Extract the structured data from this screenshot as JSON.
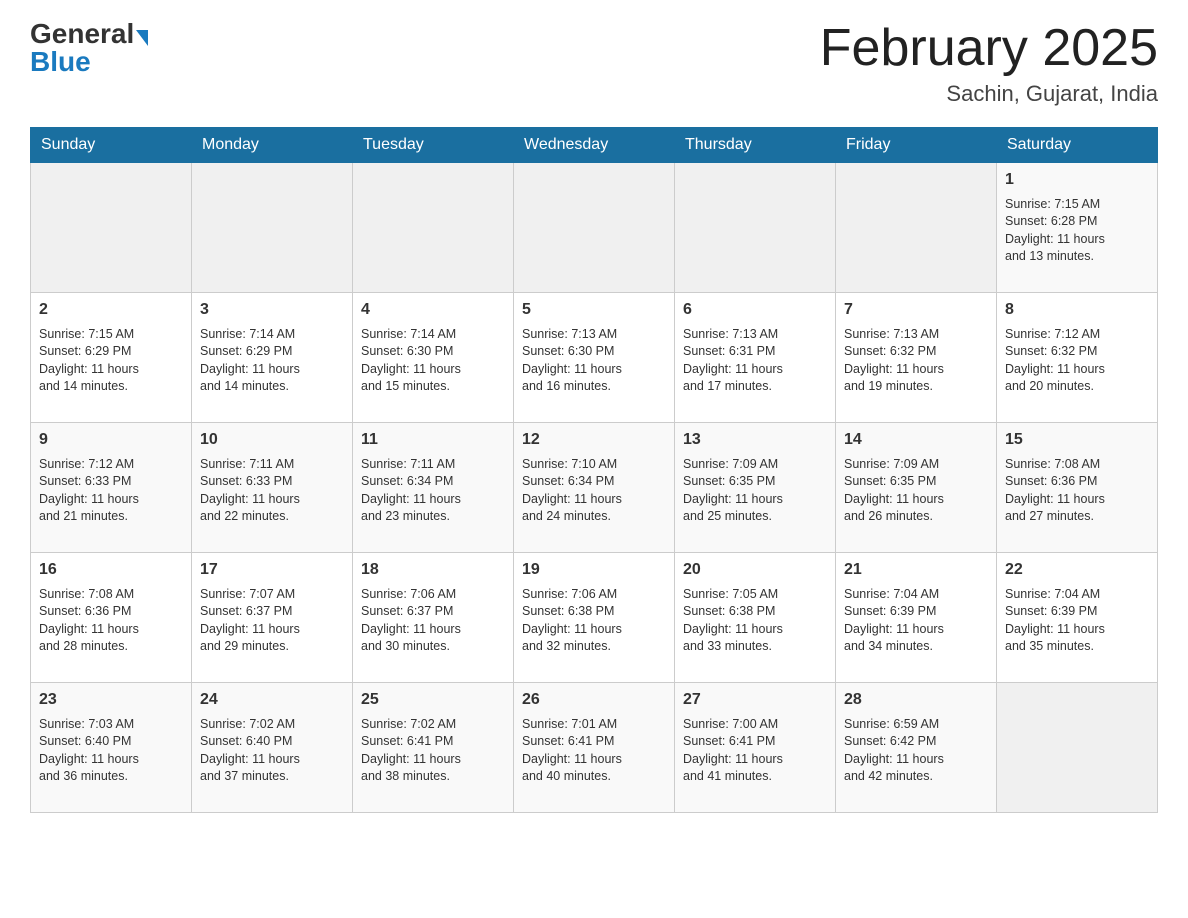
{
  "header": {
    "logo_general": "General",
    "logo_blue": "Blue",
    "month_title": "February 2025",
    "location": "Sachin, Gujarat, India"
  },
  "days_of_week": [
    "Sunday",
    "Monday",
    "Tuesday",
    "Wednesday",
    "Thursday",
    "Friday",
    "Saturday"
  ],
  "weeks": [
    {
      "days": [
        {
          "num": "",
          "info": ""
        },
        {
          "num": "",
          "info": ""
        },
        {
          "num": "",
          "info": ""
        },
        {
          "num": "",
          "info": ""
        },
        {
          "num": "",
          "info": ""
        },
        {
          "num": "",
          "info": ""
        },
        {
          "num": "1",
          "info": "Sunrise: 7:15 AM\nSunset: 6:28 PM\nDaylight: 11 hours\nand 13 minutes."
        }
      ]
    },
    {
      "days": [
        {
          "num": "2",
          "info": "Sunrise: 7:15 AM\nSunset: 6:29 PM\nDaylight: 11 hours\nand 14 minutes."
        },
        {
          "num": "3",
          "info": "Sunrise: 7:14 AM\nSunset: 6:29 PM\nDaylight: 11 hours\nand 14 minutes."
        },
        {
          "num": "4",
          "info": "Sunrise: 7:14 AM\nSunset: 6:30 PM\nDaylight: 11 hours\nand 15 minutes."
        },
        {
          "num": "5",
          "info": "Sunrise: 7:13 AM\nSunset: 6:30 PM\nDaylight: 11 hours\nand 16 minutes."
        },
        {
          "num": "6",
          "info": "Sunrise: 7:13 AM\nSunset: 6:31 PM\nDaylight: 11 hours\nand 17 minutes."
        },
        {
          "num": "7",
          "info": "Sunrise: 7:13 AM\nSunset: 6:32 PM\nDaylight: 11 hours\nand 19 minutes."
        },
        {
          "num": "8",
          "info": "Sunrise: 7:12 AM\nSunset: 6:32 PM\nDaylight: 11 hours\nand 20 minutes."
        }
      ]
    },
    {
      "days": [
        {
          "num": "9",
          "info": "Sunrise: 7:12 AM\nSunset: 6:33 PM\nDaylight: 11 hours\nand 21 minutes."
        },
        {
          "num": "10",
          "info": "Sunrise: 7:11 AM\nSunset: 6:33 PM\nDaylight: 11 hours\nand 22 minutes."
        },
        {
          "num": "11",
          "info": "Sunrise: 7:11 AM\nSunset: 6:34 PM\nDaylight: 11 hours\nand 23 minutes."
        },
        {
          "num": "12",
          "info": "Sunrise: 7:10 AM\nSunset: 6:34 PM\nDaylight: 11 hours\nand 24 minutes."
        },
        {
          "num": "13",
          "info": "Sunrise: 7:09 AM\nSunset: 6:35 PM\nDaylight: 11 hours\nand 25 minutes."
        },
        {
          "num": "14",
          "info": "Sunrise: 7:09 AM\nSunset: 6:35 PM\nDaylight: 11 hours\nand 26 minutes."
        },
        {
          "num": "15",
          "info": "Sunrise: 7:08 AM\nSunset: 6:36 PM\nDaylight: 11 hours\nand 27 minutes."
        }
      ]
    },
    {
      "days": [
        {
          "num": "16",
          "info": "Sunrise: 7:08 AM\nSunset: 6:36 PM\nDaylight: 11 hours\nand 28 minutes."
        },
        {
          "num": "17",
          "info": "Sunrise: 7:07 AM\nSunset: 6:37 PM\nDaylight: 11 hours\nand 29 minutes."
        },
        {
          "num": "18",
          "info": "Sunrise: 7:06 AM\nSunset: 6:37 PM\nDaylight: 11 hours\nand 30 minutes."
        },
        {
          "num": "19",
          "info": "Sunrise: 7:06 AM\nSunset: 6:38 PM\nDaylight: 11 hours\nand 32 minutes."
        },
        {
          "num": "20",
          "info": "Sunrise: 7:05 AM\nSunset: 6:38 PM\nDaylight: 11 hours\nand 33 minutes."
        },
        {
          "num": "21",
          "info": "Sunrise: 7:04 AM\nSunset: 6:39 PM\nDaylight: 11 hours\nand 34 minutes."
        },
        {
          "num": "22",
          "info": "Sunrise: 7:04 AM\nSunset: 6:39 PM\nDaylight: 11 hours\nand 35 minutes."
        }
      ]
    },
    {
      "days": [
        {
          "num": "23",
          "info": "Sunrise: 7:03 AM\nSunset: 6:40 PM\nDaylight: 11 hours\nand 36 minutes."
        },
        {
          "num": "24",
          "info": "Sunrise: 7:02 AM\nSunset: 6:40 PM\nDaylight: 11 hours\nand 37 minutes."
        },
        {
          "num": "25",
          "info": "Sunrise: 7:02 AM\nSunset: 6:41 PM\nDaylight: 11 hours\nand 38 minutes."
        },
        {
          "num": "26",
          "info": "Sunrise: 7:01 AM\nSunset: 6:41 PM\nDaylight: 11 hours\nand 40 minutes."
        },
        {
          "num": "27",
          "info": "Sunrise: 7:00 AM\nSunset: 6:41 PM\nDaylight: 11 hours\nand 41 minutes."
        },
        {
          "num": "28",
          "info": "Sunrise: 6:59 AM\nSunset: 6:42 PM\nDaylight: 11 hours\nand 42 minutes."
        },
        {
          "num": "",
          "info": ""
        }
      ]
    }
  ]
}
